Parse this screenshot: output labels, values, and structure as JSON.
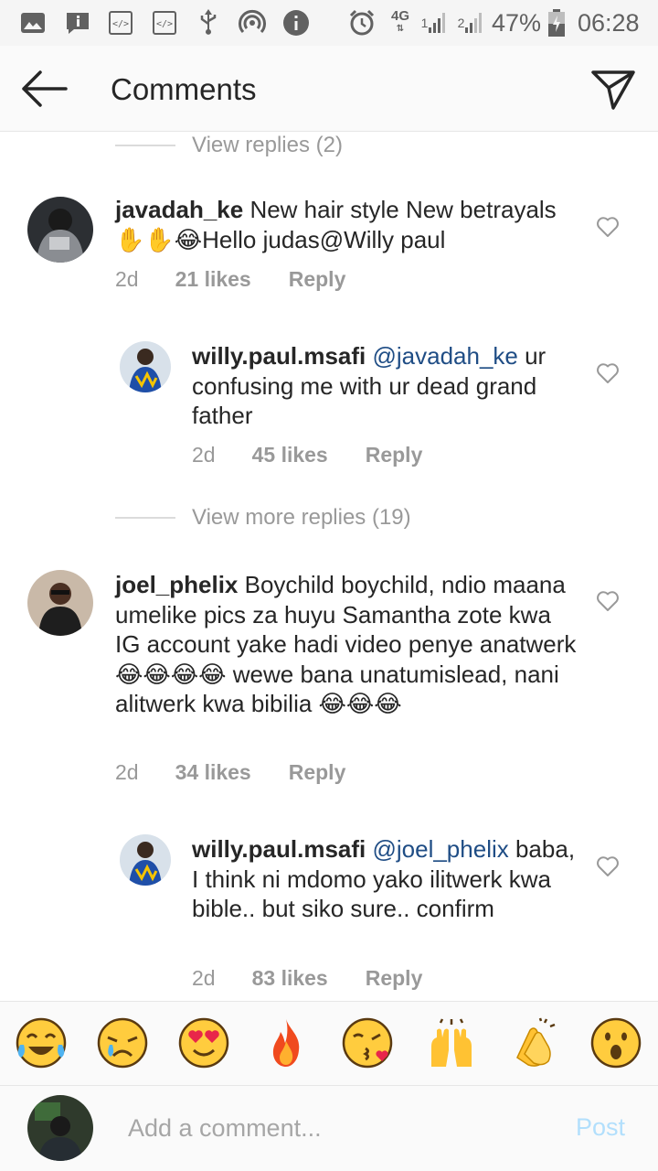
{
  "status_bar": {
    "network": "4G",
    "sim1": "1",
    "sim2": "2",
    "battery": "47%",
    "time": "06:28",
    "icons": [
      "gallery-icon",
      "info-square-icon",
      "code-icon",
      "code-icon",
      "usb-icon",
      "hotspot-icon",
      "info-icon",
      "alarm-icon",
      "signal-icon",
      "battery-icon"
    ]
  },
  "header": {
    "title": "Comments",
    "back_icon": "arrow-left-icon",
    "send_icon": "paper-plane-icon"
  },
  "view_replies": "View replies (2)",
  "view_more_replies": "View more replies (19)",
  "comments": [
    {
      "username": "javadah_ke",
      "text": " New hair style New betrayals✋✋😂Hello judas@Willy paul",
      "time": "2d",
      "likes": "21 likes",
      "reply": "Reply"
    },
    {
      "username": "willy.paul.msafi",
      "mention": "@javadah_ke",
      "text": " ur confusing me with ur dead grand father",
      "time": "2d",
      "likes": "45 likes",
      "reply": "Reply"
    },
    {
      "username": "joel_phelix",
      "text": " Boychild boychild, ndio maana umelike pics za huyu Samantha zote kwa IG account yake hadi video penye anatwerk😂😂😂😂 wewe bana unatumislead, nani alitwerk kwa bibilia 😂😂😂",
      "time": "2d",
      "likes": "34 likes",
      "reply": "Reply"
    },
    {
      "username": "willy.paul.msafi",
      "mention": "@joel_phelix",
      "text": " baba, I think ni mdomo yako ilitwerk kwa bible.. but siko sure.. confirm",
      "time": "2d",
      "likes": "83 likes",
      "reply": "Reply"
    }
  ],
  "emoji_bar": [
    "😂",
    "😢",
    "😍",
    "🔥",
    "😘",
    "🙌",
    "👏",
    "😮"
  ],
  "composer": {
    "placeholder": "Add a comment...",
    "post_label": "Post"
  },
  "colors": {
    "mention": "#1f4d85",
    "muted": "#999999",
    "post_disabled": "#b2dffc"
  }
}
